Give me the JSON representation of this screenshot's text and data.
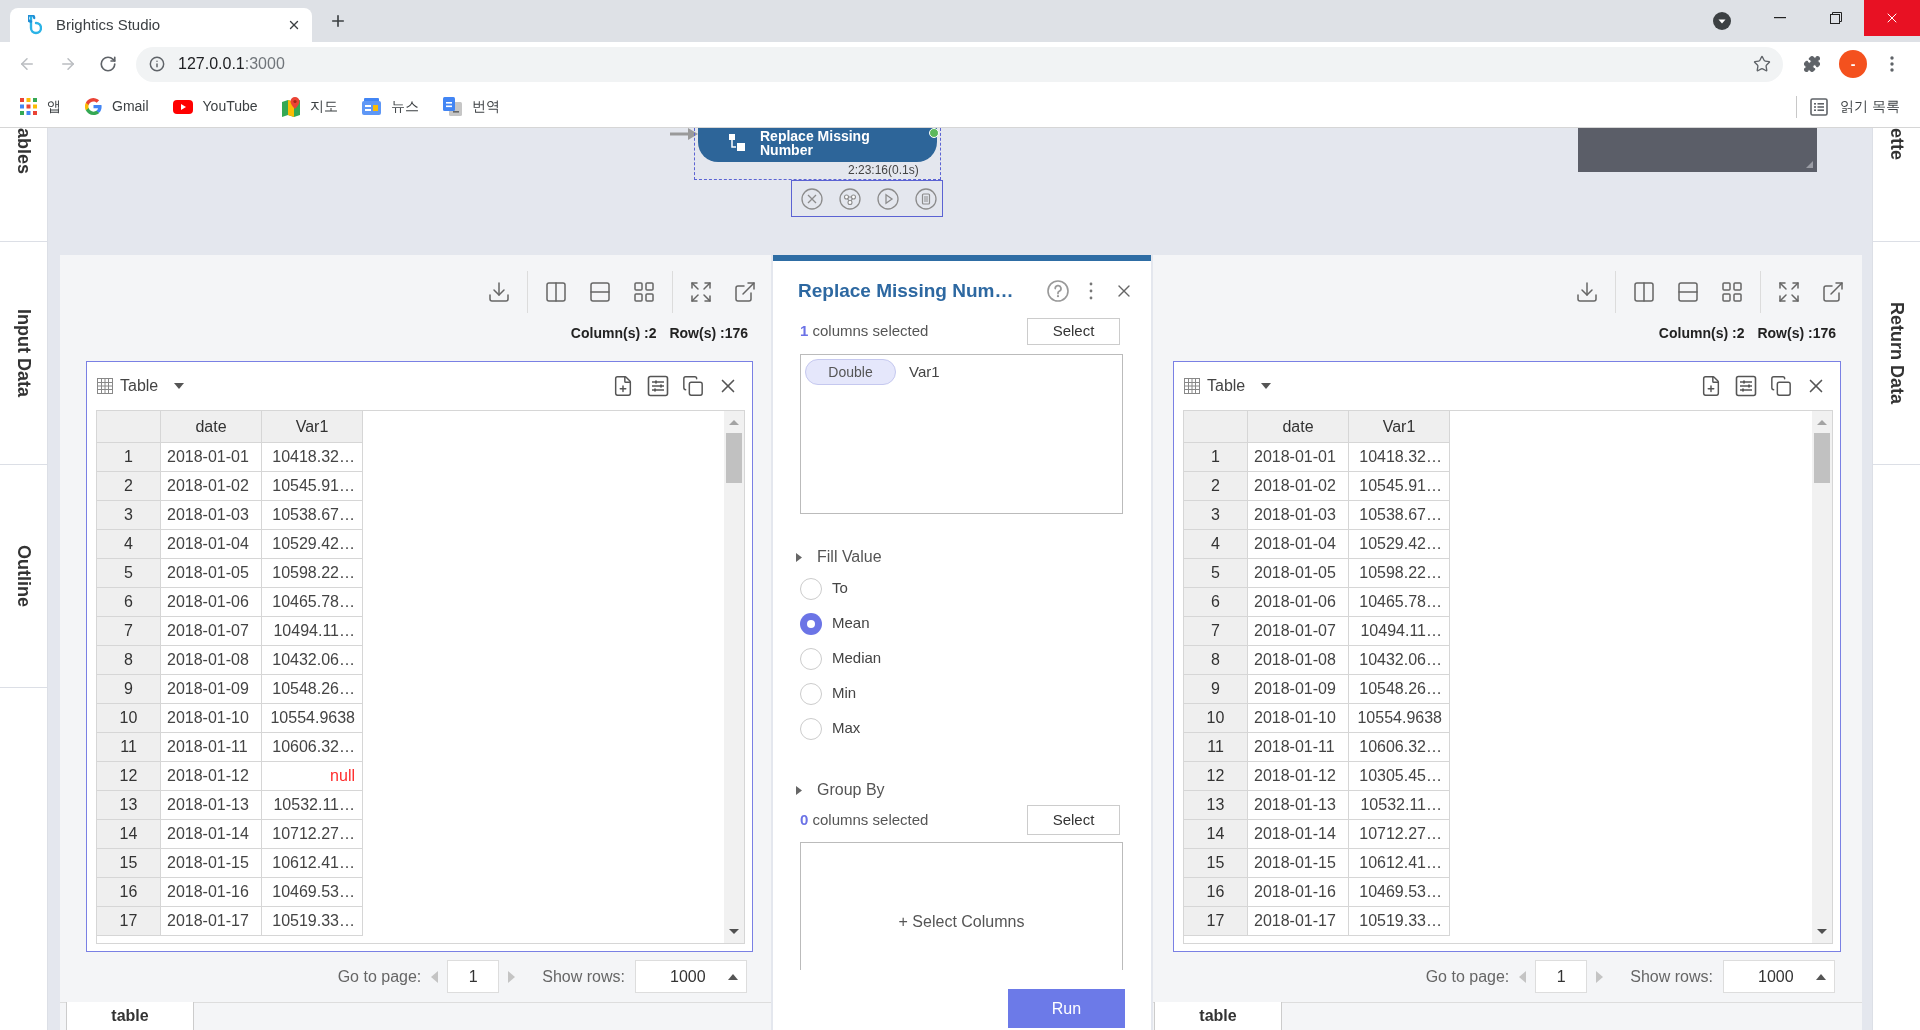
{
  "browser": {
    "tab_title": "Brightics Studio",
    "url_host": "127.0.0.1",
    "url_port": ":3000",
    "profile": "-",
    "bookmarks": [
      {
        "kind": "apps",
        "label": "앱"
      },
      {
        "kind": "google",
        "label": "Gmail"
      },
      {
        "kind": "youtube",
        "label": "YouTube"
      },
      {
        "kind": "maps",
        "label": "지도"
      },
      {
        "kind": "news",
        "label": "뉴스"
      },
      {
        "kind": "translate",
        "label": "번역"
      }
    ],
    "reading_list": "읽기 목록"
  },
  "left_sidebar": {
    "tabs": [
      {
        "label": "ables"
      },
      {
        "label": "Input Data"
      },
      {
        "label": "Outline"
      }
    ]
  },
  "canvas": {
    "node": {
      "title": "Replace Missing Number",
      "time": "2:23:16(0.1s)",
      "selected": true
    }
  },
  "input_data": {
    "columns_count": "Column(s) :2",
    "rows_count": "Row(s) :176",
    "table": {
      "title": "Table",
      "columns": [
        "date",
        "Var1"
      ],
      "rows": [
        {
          "number": "1",
          "date": "2018-01-01",
          "var1": "10418.32…",
          "missing": false
        },
        {
          "number": "2",
          "date": "2018-01-02",
          "var1": "10545.91…",
          "missing": false
        },
        {
          "number": "3",
          "date": "2018-01-03",
          "var1": "10538.67…",
          "missing": false
        },
        {
          "number": "4",
          "date": "2018-01-04",
          "var1": "10529.42…",
          "missing": false
        },
        {
          "number": "5",
          "date": "2018-01-05",
          "var1": "10598.22…",
          "missing": false
        },
        {
          "number": "6",
          "date": "2018-01-06",
          "var1": "10465.78…",
          "missing": false
        },
        {
          "number": "7",
          "date": "2018-01-07",
          "var1": "10494.11…",
          "missing": false
        },
        {
          "number": "8",
          "date": "2018-01-08",
          "var1": "10432.06…",
          "missing": false
        },
        {
          "number": "9",
          "date": "2018-01-09",
          "var1": "10548.26…",
          "missing": false
        },
        {
          "number": "10",
          "date": "2018-01-10",
          "var1": "10554.9638",
          "missing": false
        },
        {
          "number": "11",
          "date": "2018-01-11",
          "var1": "10606.32…",
          "missing": false
        },
        {
          "number": "12",
          "date": "2018-01-12",
          "var1": "null",
          "missing": true
        },
        {
          "number": "13",
          "date": "2018-01-13",
          "var1": "10532.11…",
          "missing": false
        },
        {
          "number": "14",
          "date": "2018-01-14",
          "var1": "10712.27…",
          "missing": false
        },
        {
          "number": "15",
          "date": "2018-01-15",
          "var1": "10612.41…",
          "missing": false
        },
        {
          "number": "16",
          "date": "2018-01-16",
          "var1": "10469.53…",
          "missing": false
        },
        {
          "number": "17",
          "date": "2018-01-17",
          "var1": "10519.33…",
          "missing": false
        }
      ]
    },
    "pagination": {
      "label": "Go to page:",
      "page": "1",
      "rows_label": "Show rows:",
      "rows_value": "1000"
    },
    "tabs": [
      {
        "label": "table",
        "selected": true
      }
    ]
  },
  "function": {
    "title": "Replace Missing Num…",
    "target": {
      "summary": "**1** columns selected",
      "button": "Select",
      "columns": [
        {
          "type": "Double",
          "name": "Var1"
        }
      ]
    },
    "fill_value": {
      "label": "Fill Value",
      "options": [
        {
          "label": "To",
          "selected": false
        },
        {
          "label": "Mean",
          "selected": true
        },
        {
          "label": "Median",
          "selected": false
        },
        {
          "label": "Min",
          "selected": false
        },
        {
          "label": "Max",
          "selected": false
        }
      ]
    },
    "group_by": {
      "label": "Group By",
      "summary": "**0** columns selected",
      "button": "Select",
      "prompt": "+ Select Columns"
    },
    "run_button": "Run"
  },
  "output_data": {
    "columns_count": "Column(s) :2",
    "rows_count": "Row(s) :176",
    "table": {
      "title": "Table",
      "columns": [
        "date",
        "Var1"
      ],
      "rows": [
        {
          "number": "1",
          "date": "2018-01-01",
          "var1": "10418.32…",
          "missing": false
        },
        {
          "number": "2",
          "date": "2018-01-02",
          "var1": "10545.91…",
          "missing": false
        },
        {
          "number": "3",
          "date": "2018-01-03",
          "var1": "10538.67…",
          "missing": false
        },
        {
          "number": "4",
          "date": "2018-01-04",
          "var1": "10529.42…",
          "missing": false
        },
        {
          "number": "5",
          "date": "2018-01-05",
          "var1": "10598.22…",
          "missing": false
        },
        {
          "number": "6",
          "date": "2018-01-06",
          "var1": "10465.78…",
          "missing": false
        },
        {
          "number": "7",
          "date": "2018-01-07",
          "var1": "10494.11…",
          "missing": false
        },
        {
          "number": "8",
          "date": "2018-01-08",
          "var1": "10432.06…",
          "missing": false
        },
        {
          "number": "9",
          "date": "2018-01-09",
          "var1": "10548.26…",
          "missing": false
        },
        {
          "number": "10",
          "date": "2018-01-10",
          "var1": "10554.9638",
          "missing": false
        },
        {
          "number": "11",
          "date": "2018-01-11",
          "var1": "10606.32…",
          "missing": false
        },
        {
          "number": "12",
          "date": "2018-01-12",
          "var1": "10305.45…",
          "missing": false
        },
        {
          "number": "13",
          "date": "2018-01-13",
          "var1": "10532.11…",
          "missing": false
        },
        {
          "number": "14",
          "date": "2018-01-14",
          "var1": "10712.27…",
          "missing": false
        },
        {
          "number": "15",
          "date": "2018-01-15",
          "var1": "10612.41…",
          "missing": false
        },
        {
          "number": "16",
          "date": "2018-01-16",
          "var1": "10469.53…",
          "missing": false
        },
        {
          "number": "17",
          "date": "2018-01-17",
          "var1": "10519.33…",
          "missing": false
        }
      ]
    },
    "pagination": {
      "label": "Go to page:",
      "page": "1",
      "rows_label": "Show rows:",
      "rows_value": "1000"
    },
    "tabs": [
      {
        "label": "table",
        "selected": true
      }
    ]
  },
  "right_sidebar": {
    "tabs": [
      {
        "label": "ette"
      },
      {
        "label": "Return Data"
      }
    ]
  }
}
